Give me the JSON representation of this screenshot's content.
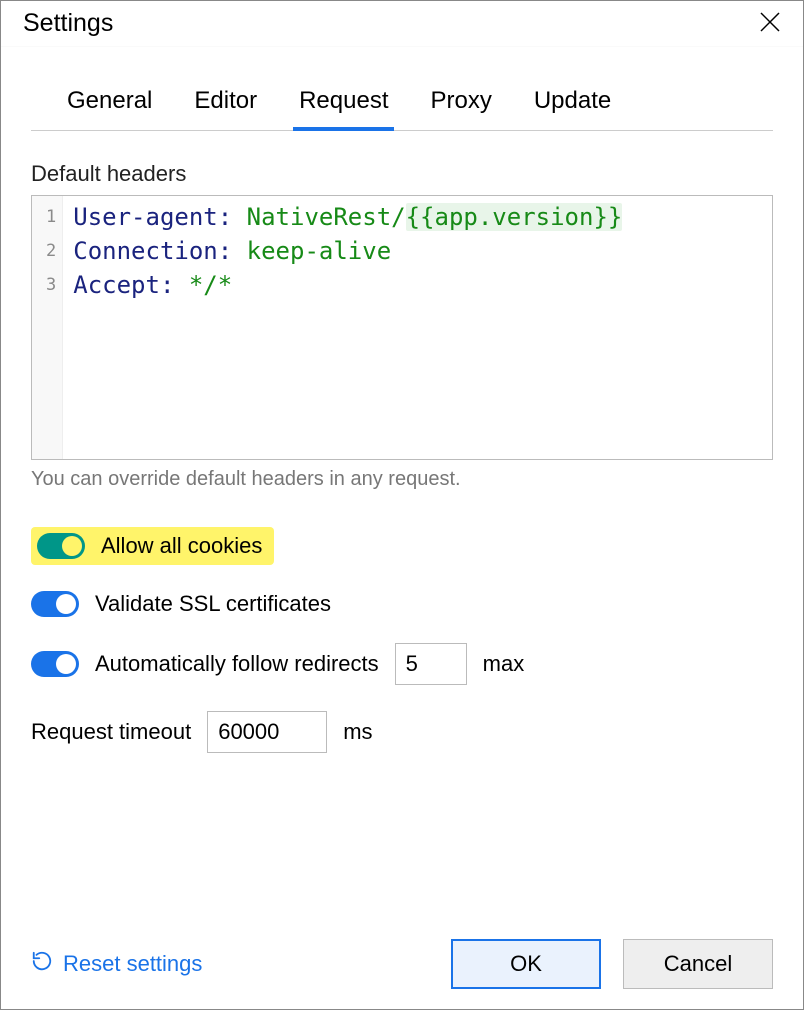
{
  "titlebar": {
    "title": "Settings"
  },
  "tabs": {
    "items": [
      "General",
      "Editor",
      "Request",
      "Proxy",
      "Update"
    ],
    "active_index": 2
  },
  "headers_section": {
    "label": "Default headers",
    "hint": "You can override default headers in any request.",
    "lines": [
      {
        "num": "1",
        "key": "User-agent",
        "val_prefix": "NativeRest/",
        "var": "{{app.version}}",
        "val_suffix": ""
      },
      {
        "num": "2",
        "key": "Connection",
        "val_prefix": "keep-alive",
        "var": "",
        "val_suffix": ""
      },
      {
        "num": "3",
        "key": "Accept",
        "val_prefix": "*/*",
        "var": "",
        "val_suffix": ""
      }
    ]
  },
  "options": {
    "allow_cookies": {
      "label": "Allow all cookies",
      "on": true,
      "highlight": true
    },
    "validate_ssl": {
      "label": "Validate SSL certificates",
      "on": true
    },
    "follow_redirects": {
      "label": "Automatically follow redirects",
      "on": true,
      "max_value": "5",
      "max_unit": "max"
    },
    "timeout": {
      "label": "Request timeout",
      "value": "60000",
      "unit": "ms"
    }
  },
  "footer": {
    "reset_label": "Reset settings",
    "ok_label": "OK",
    "cancel_label": "Cancel"
  }
}
